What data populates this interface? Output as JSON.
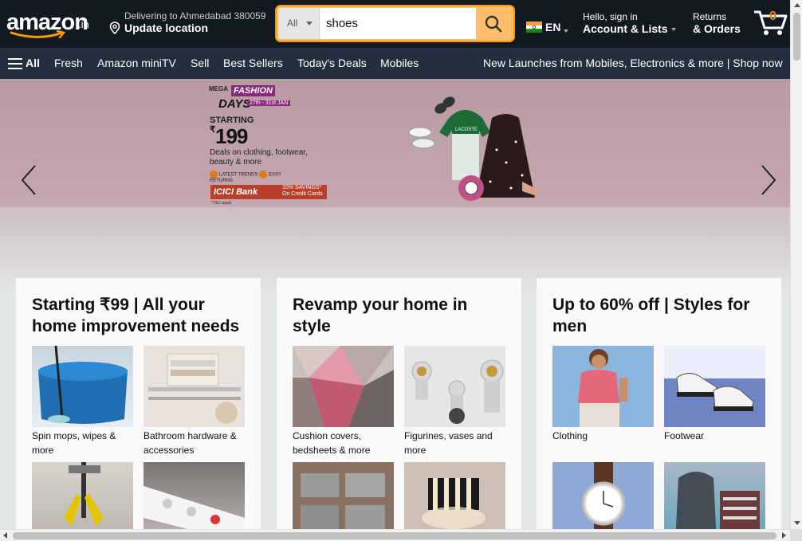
{
  "header": {
    "logo_text": "amazon",
    "logo_tld": ".in",
    "deliver_line1": "Delivering to Ahmedabad 380059",
    "deliver_line2": "Update location",
    "search_category": "All",
    "search_value": "shoes",
    "language": "EN",
    "account_line1": "Hello, sign in",
    "account_line2": "Account & Lists",
    "orders_line1": "Returns",
    "orders_line2": "& Orders",
    "cart_count": "0"
  },
  "subnav": {
    "all_label": "All",
    "items": [
      "Fresh",
      "Amazon miniTV",
      "Sell",
      "Best Sellers",
      "Today's Deals",
      "Mobiles"
    ],
    "promo": "New Launches from Mobiles, Electronics & more | Shop now"
  },
  "hero": {
    "mega": "MEGA",
    "fashion": "FASHION",
    "days": "DAYS",
    "dates": "27th - 31st JAN",
    "starting": "STARTING",
    "currency": "₹",
    "price": "199",
    "deals": "Deals on clothing, footwear, beauty & more",
    "badge1": "LATEST TRENDS",
    "badge2": "EASY RETURNS",
    "bank": "ICICI Bank",
    "bank_offer": "10% SAVINGS* On Credit Cards",
    "tnc": "*T&C apply"
  },
  "cards": [
    {
      "title": "Starting ₹99 | All your home improvement needs",
      "tiles": [
        {
          "caption": "Spin mops, wipes & more"
        },
        {
          "caption": "Bathroom hardware & accessories"
        },
        {
          "caption": ""
        },
        {
          "caption": ""
        }
      ]
    },
    {
      "title": "Revamp your home in style",
      "tiles": [
        {
          "caption": "Cushion covers, bedsheets & more"
        },
        {
          "caption": "Figurines, vases and more"
        },
        {
          "caption": ""
        },
        {
          "caption": ""
        }
      ]
    },
    {
      "title": "Up to 60% off | Styles for men",
      "tiles": [
        {
          "caption": "Clothing"
        },
        {
          "caption": "Footwear"
        },
        {
          "caption": ""
        },
        {
          "caption": ""
        }
      ]
    }
  ],
  "colors": {
    "header_bg": "#131921",
    "subnav_bg": "#232f3e",
    "search_button": "#febd69",
    "cart_count": "#f08804"
  }
}
